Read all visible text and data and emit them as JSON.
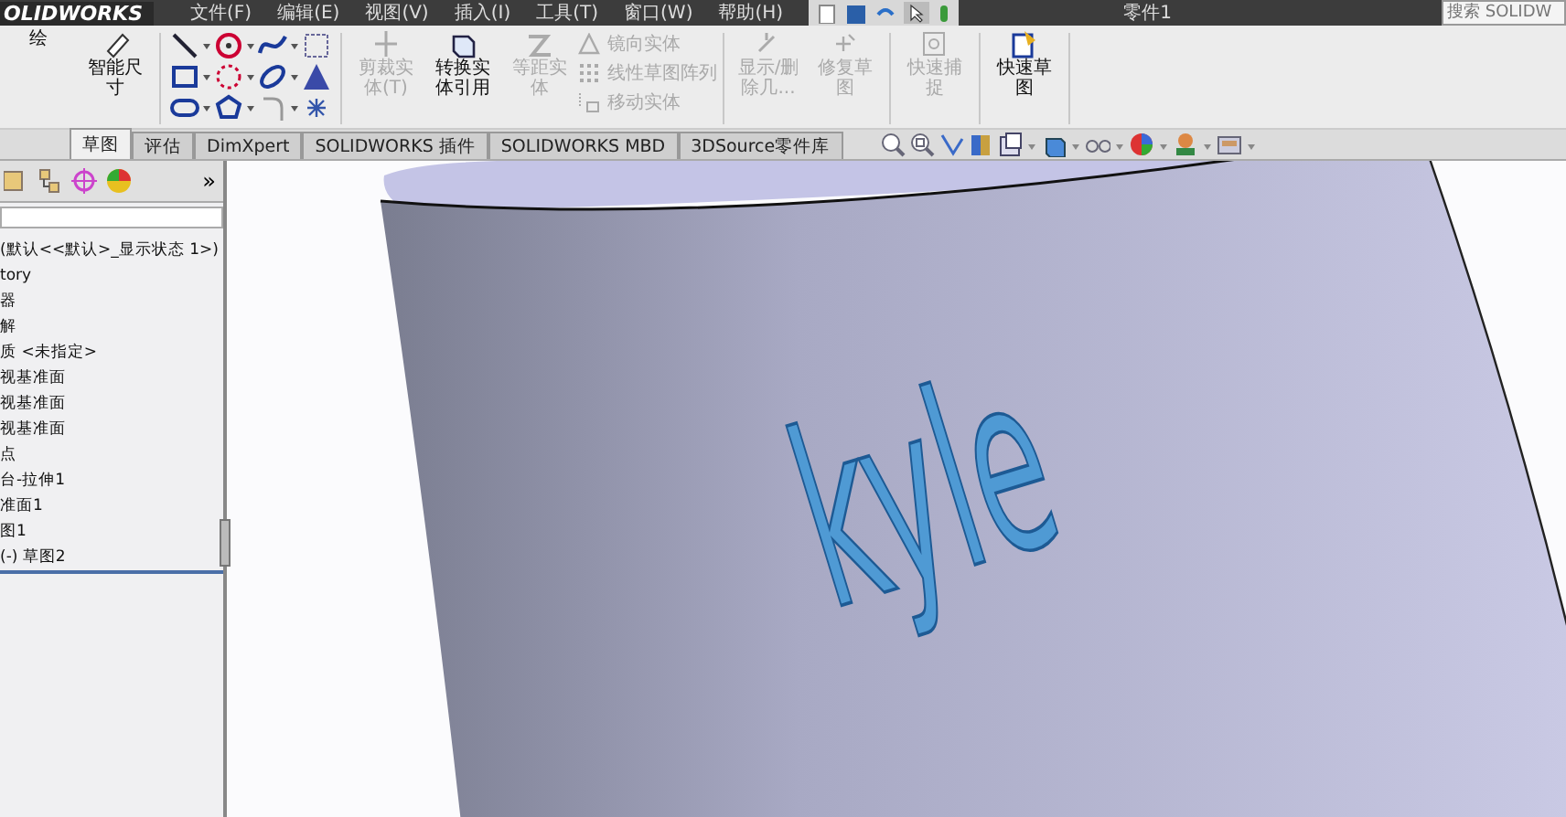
{
  "title_bar": {
    "logo": "OLIDWORKS",
    "menus": [
      "文件(F)",
      "编辑(E)",
      "视图(V)",
      "插入(I)",
      "工具(T)",
      "窗口(W)",
      "帮助(H)"
    ],
    "document": "零件1",
    "search": {
      "placeholder": "搜索 SOLIDW"
    }
  },
  "ribbon": {
    "big_buttons": [
      {
        "label": "绘",
        "disabled": false
      },
      {
        "label": "智能尺寸",
        "disabled": false
      }
    ],
    "tools": [
      {
        "label": "剪裁实体(T)",
        "disabled": true
      },
      {
        "label": "转换实体引用",
        "disabled": false
      },
      {
        "label": "等距实体",
        "disabled": true
      }
    ],
    "list": [
      {
        "label": "镜向实体",
        "disabled": true
      },
      {
        "label": "线性草图阵列",
        "disabled": true
      },
      {
        "label": "移动实体",
        "disabled": true
      }
    ],
    "extra": [
      {
        "label": "显示/删除几...",
        "disabled": true
      },
      {
        "label": "修复草图",
        "disabled": true
      },
      {
        "label": "快速捕捉",
        "disabled": true
      },
      {
        "label": "快速草图",
        "disabled": false
      }
    ]
  },
  "tabs": [
    {
      "label": "草图",
      "selected": true
    },
    {
      "label": "评估",
      "selected": false
    },
    {
      "label": "DimXpert",
      "selected": false
    },
    {
      "label": "SOLIDWORKS 插件",
      "selected": false
    },
    {
      "label": "SOLIDWORKS MBD",
      "selected": false
    },
    {
      "label": "3DSource零件库",
      "selected": false
    }
  ],
  "feature_tree": {
    "expand_label": "»",
    "items": [
      {
        "label": "(默认<<默认>_显示状态 1>)"
      },
      {
        "label": "tory"
      },
      {
        "label": "器"
      },
      {
        "label": "解"
      },
      {
        "label": "质 <未指定>"
      },
      {
        "label": "视基准面"
      },
      {
        "label": "视基准面"
      },
      {
        "label": "视基准面"
      },
      {
        "label": "点"
      },
      {
        "label": "台-拉伸1"
      },
      {
        "label": "准面1"
      },
      {
        "label": "图1"
      },
      {
        "label": "(-) 草图2"
      }
    ]
  },
  "viewport": {
    "model_text": "kyle"
  }
}
